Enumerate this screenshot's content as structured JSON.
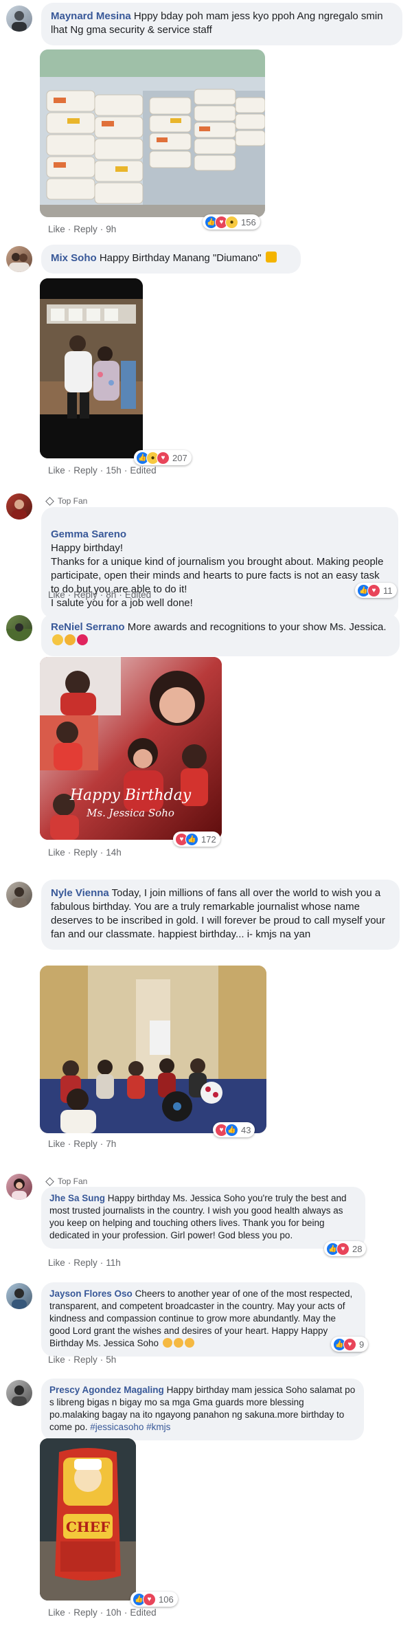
{
  "actions": {
    "like": "Like",
    "reply": "Reply",
    "edited": "Edited",
    "sep": "·"
  },
  "top_fan_label": "Top Fan",
  "comments": [
    {
      "name": "Maynard Mesina",
      "text": "Hppy bday poh mam jess kyo ppoh Ang ngregalo smin lhat Ng gma security & service staff",
      "time": "9h",
      "count": "156"
    },
    {
      "name": "Mix Soho",
      "text": "Happy Birthday Manang \"Diumano\"",
      "time": "15h",
      "count": "207"
    },
    {
      "name": "Gemma Sareno",
      "text": "Happy birthday!\nThanks for a unique kind of journalism you brought about. Making people participate, open their minds and hearts to pure facts is not an easy task to do but you are able to do it!\nI salute you for a job well done!",
      "time": "8h",
      "count": "11"
    },
    {
      "name": "ReNiel Serrano",
      "text": "More awards and recognitions to your show Ms. Jessica.",
      "time": "14h",
      "count": "172",
      "photo_text_1": "Happy Birthday",
      "photo_text_2": "Ms. Jessica Soho"
    },
    {
      "name": "Nyle Vienna",
      "text": "Today, I join millions of fans all over the world to wish you a fabulous birthday. You are a truly remarkable journalist whose name deserves to be inscribed in gold. I will forever be proud to call myself your fan and our classmate. happiest birthday... i- kmjs na yan",
      "time": "7h",
      "count": "43"
    },
    {
      "name": "Jhe Sa Sung",
      "text": "Happy birthday Ms. Jessica Soho you're truly the best and most trusted journalists in the country. I wish you good health always as you keep on helping and touching others lives. Thank you for being dedicated in your profession. Girl power! God bless you po.",
      "time": "11h",
      "count": "28"
    },
    {
      "name": "Jayson Flores Oso",
      "text": "Cheers to another year of one of the most respected, transparent, and competent broadcaster in the country. May your acts of kindness and compassion continue to grow more abundantly. May the good Lord grant the wishes and desires of your heart. Happy Happy Birthday Ms. Jessica Soho",
      "time": "5h",
      "count": "9"
    },
    {
      "name": "Prescy Agondez Magaling",
      "text": "Happy birthday mam jessica Soho salamat po s libreng bigas n bigay mo sa mga Gma guards more blessing po.malaking bagay na ito ngayong panahon ng sakuna.more birthday to come po.",
      "hashtag1": "#jessicasoho",
      "hashtag2": "#kmjs",
      "time": "10h",
      "count": "106",
      "photo_text": "CHEF"
    }
  ]
}
